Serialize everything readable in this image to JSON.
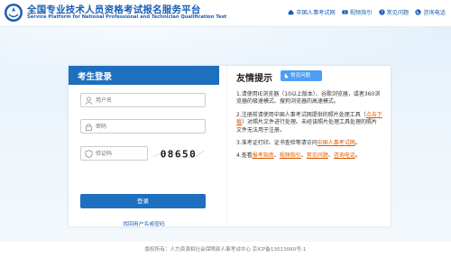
{
  "header": {
    "title_cn": "全国专业技术人员资格考试报名服务平台",
    "title_en": "Service Platform for National Professional and Technician Qualification Test",
    "nav": [
      "中国人事考试网",
      "视频指引",
      "常见问题",
      "咨询电话"
    ]
  },
  "login": {
    "title": "考生登录",
    "username_placeholder": "用户名",
    "password_placeholder": "密码",
    "captcha_placeholder": "验证码",
    "captcha_code": "08650",
    "login_button": "登录",
    "forgot_link": "找回用户名或密码"
  },
  "tips": {
    "title": "友情提示",
    "badge": "常见问题",
    "t1": "1.请使用IE浏览器（10以上版本）、谷歌浏览器，或者360浏览器的极速模式、搜狗浏览器的高速模式。",
    "t2a": "2.注册前请使用中国人事考试网提供的照片处理工具（",
    "t2link": "点击下载",
    "t2b": "）对照片文件进行处理。未经该照片处理工具处理的照片文件无法用于注册。",
    "t3a": "3.准考证打印、证书查验等请访问",
    "t3link": "中国人事考试网",
    "t3b": "。",
    "t4a": "4.查看",
    "t4l1": "报考指南",
    "t4l2": "视频指引",
    "t4l3": "常见问题",
    "t4l4": "咨询电话",
    "sep": "、",
    "end": "。"
  },
  "footer": {
    "text": "版权所有：人力资源和社会保障部人事考试中心 京ICP备13013060号-1"
  },
  "colors": {
    "primary": "#1e6fbd",
    "link": "#1a5fb4",
    "highlight": "#e05a00",
    "badge": "#4e9ef5"
  }
}
